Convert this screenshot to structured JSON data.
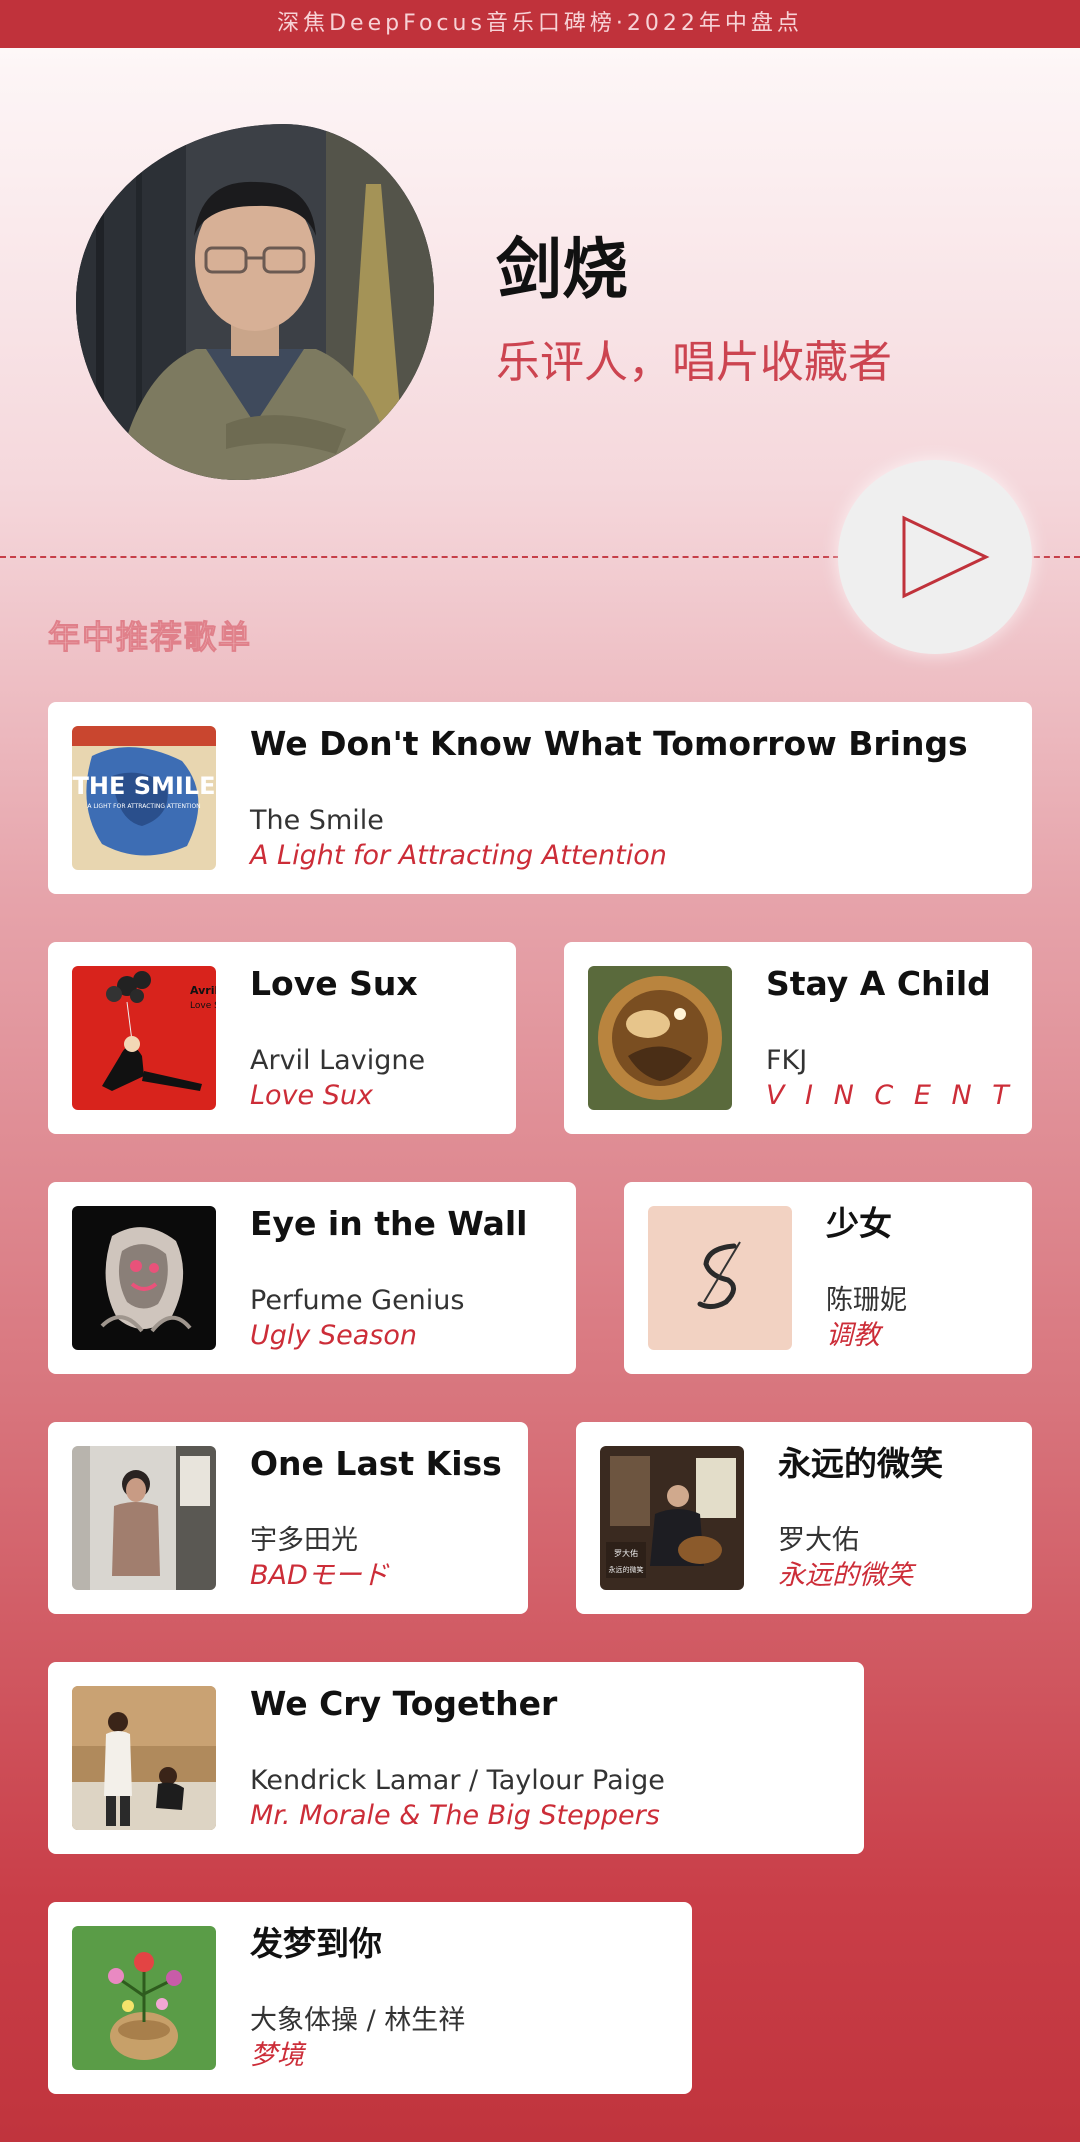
{
  "header": {
    "banner_text": "深焦DeepFocus音乐口碑榜·2022年中盘点"
  },
  "profile": {
    "name": "剑烧",
    "subtitle": "乐评人，唱片收藏者"
  },
  "section": {
    "title": "年中推荐歌单"
  },
  "colors": {
    "accent": "#c0323b",
    "album_text": "#cc2d38",
    "subtitle": "#cc4450"
  },
  "playlist": [
    {
      "title": "We Don't Know What Tomorrow Brings",
      "artist": "The Smile",
      "album": "A Light for Attracting Attention"
    },
    {
      "title": "Love Sux",
      "artist": "Arvil Lavigne",
      "album": "Love Sux"
    },
    {
      "title": "Stay A Child",
      "artist": "FKJ",
      "album": "V I N C E N T"
    },
    {
      "title": "Eye in the Wall",
      "artist": "Perfume Genius",
      "album": "Ugly Season"
    },
    {
      "title": "少女",
      "artist": "陈珊妮",
      "album": "调教"
    },
    {
      "title": "One Last Kiss",
      "artist": "宇多田光",
      "album": "BADモード"
    },
    {
      "title": "永远的微笑",
      "artist": "罗大佑",
      "album": "永远的微笑"
    },
    {
      "title": "We Cry Together",
      "artist": "Kendrick Lamar / Taylour Paige",
      "album": "Mr. Morale & The Big Steppers"
    },
    {
      "title": "发梦到你",
      "artist": "大象体操 / 林生祥",
      "album": "梦境"
    }
  ],
  "icons": {
    "play": "play-icon"
  }
}
